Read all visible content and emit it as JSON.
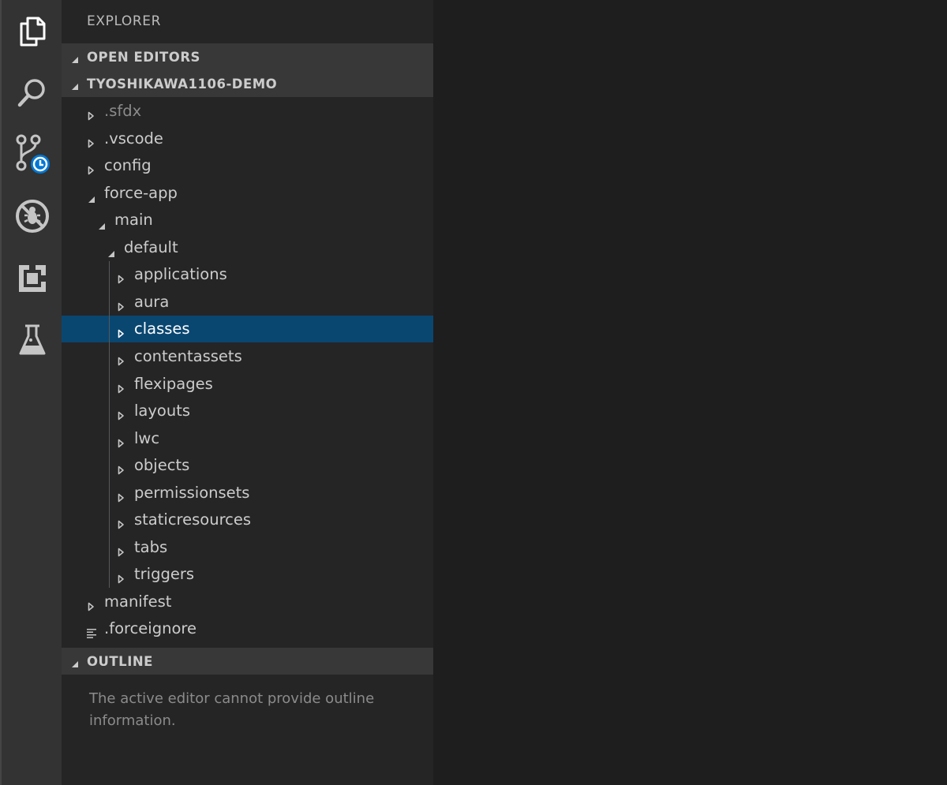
{
  "activity_bar": {
    "items": [
      {
        "icon": "files-icon"
      },
      {
        "icon": "search-icon"
      },
      {
        "icon": "source-control-icon"
      },
      {
        "icon": "debug-icon"
      },
      {
        "icon": "extensions-icon"
      },
      {
        "icon": "test-flask-icon"
      }
    ],
    "colors": {
      "badge": "#0078d4",
      "icon_active": "#ffffff",
      "icon": "#c5c5c5"
    }
  },
  "sidebar": {
    "title": "EXPLORER",
    "sections": {
      "open_editors": "OPEN EDITORS",
      "project": "TYOSHIKAWA1106-DEMO",
      "outline": "OUTLINE"
    },
    "tree": [
      {
        "label": ".sfdx",
        "type": "folder",
        "expanded": false,
        "level": 0,
        "dim": true
      },
      {
        "label": ".vscode",
        "type": "folder",
        "expanded": false,
        "level": 0
      },
      {
        "label": "config",
        "type": "folder",
        "expanded": false,
        "level": 0
      },
      {
        "label": "force-app",
        "type": "folder",
        "expanded": true,
        "level": 0
      },
      {
        "label": "main",
        "type": "folder",
        "expanded": true,
        "level": 1
      },
      {
        "label": "default",
        "type": "folder",
        "expanded": true,
        "level": 2
      },
      {
        "label": "applications",
        "type": "folder",
        "expanded": false,
        "level": 3
      },
      {
        "label": "aura",
        "type": "folder",
        "expanded": false,
        "level": 3
      },
      {
        "label": "classes",
        "type": "folder",
        "expanded": false,
        "level": 3,
        "selected": true
      },
      {
        "label": "contentassets",
        "type": "folder",
        "expanded": false,
        "level": 3
      },
      {
        "label": "flexipages",
        "type": "folder",
        "expanded": false,
        "level": 3
      },
      {
        "label": "layouts",
        "type": "folder",
        "expanded": false,
        "level": 3
      },
      {
        "label": "lwc",
        "type": "folder",
        "expanded": false,
        "level": 3
      },
      {
        "label": "objects",
        "type": "folder",
        "expanded": false,
        "level": 3
      },
      {
        "label": "permissionsets",
        "type": "folder",
        "expanded": false,
        "level": 3
      },
      {
        "label": "staticresources",
        "type": "folder",
        "expanded": false,
        "level": 3
      },
      {
        "label": "tabs",
        "type": "folder",
        "expanded": false,
        "level": 3
      },
      {
        "label": "triggers",
        "type": "folder",
        "expanded": false,
        "level": 3
      },
      {
        "label": "manifest",
        "type": "folder",
        "expanded": false,
        "level": 0
      },
      {
        "label": ".forceignore",
        "type": "file",
        "level": 0
      }
    ],
    "outline_message": "The active editor cannot provide outline information."
  }
}
